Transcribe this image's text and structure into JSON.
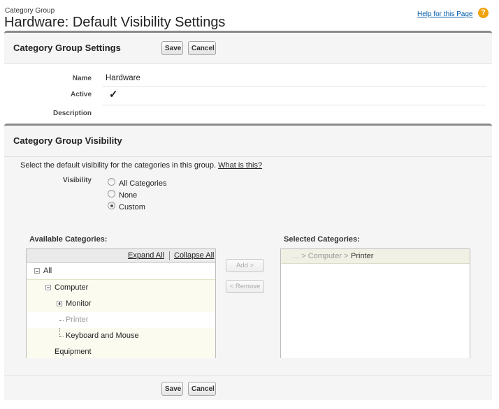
{
  "header": {
    "breadcrumb": "Category Group",
    "title": "Hardware: Default Visibility Settings",
    "help_link": "Help for this Page"
  },
  "settings": {
    "title": "Category Group Settings",
    "save_label": "Save",
    "cancel_label": "Cancel",
    "fields": {
      "name_label": "Name",
      "name_value": "Hardware",
      "active_label": "Active",
      "active_value": "✓",
      "description_label": "Description"
    }
  },
  "visibility": {
    "title": "Category Group Visibility",
    "intro": "Select the default visibility for the categories in this group.",
    "intro_link": "What is this?",
    "visibility_label": "Visibility",
    "options": {
      "all": "All Categories",
      "none": "None",
      "custom": "Custom"
    },
    "selected_option": "custom"
  },
  "available": {
    "label": "Available Categories:",
    "expand_all": "Expand All",
    "collapse_all": "Collapse All",
    "nodes": {
      "all": "All",
      "computer": "Computer",
      "monitor": "Monitor",
      "printer": "Printer",
      "keyboard": "Keyboard and Mouse",
      "equipment": "Equipment"
    }
  },
  "mover": {
    "add_label": "Add >",
    "remove_label": "< Remove"
  },
  "selected": {
    "label": "Selected Categories:",
    "path_prefix": "... > Computer >",
    "path_leaf": "Printer"
  },
  "footer": {
    "save_label": "Save",
    "cancel_label": "Cancel"
  },
  "colors": {
    "link": "#015ba7",
    "help_icon": "#f0a30a",
    "panel_border": "#8a8a8a"
  }
}
